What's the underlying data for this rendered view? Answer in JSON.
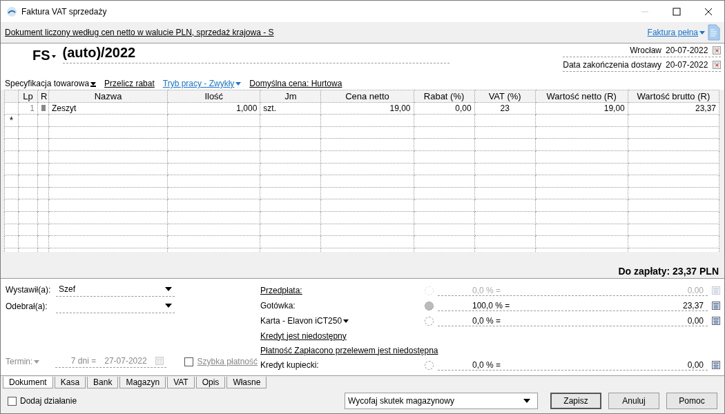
{
  "window": {
    "title": "Faktura VAT sprzedaży"
  },
  "info_bar": {
    "text": "Dokument liczony według cen netto w walucie PLN, sprzedaż krajowa - S",
    "invoice_kind": "Faktura pełna"
  },
  "header": {
    "doc_type": "FS",
    "number": "(auto)/2022",
    "place": "Wrocław",
    "issue_date": "20-07-2022",
    "delivery_label": "Data zakończenia dostawy",
    "delivery_date": "20-07-2022"
  },
  "toolbar": {
    "spec": "Specyfikacja towarowa",
    "recalc": "Przelicz rabat",
    "mode": "Tryb pracy - Zwykły",
    "default_price": "Domyślna cena: Hurtowa"
  },
  "table": {
    "columns": [
      "Lp",
      "R",
      "Nazwa",
      "Ilość",
      "Jm",
      "Cena netto",
      "Rabat (%)",
      "VAT (%)",
      "Wartość netto (R)",
      "Wartość brutto (R)"
    ],
    "rows": [
      [
        "1",
        "",
        "Zeszyt",
        "1,000",
        "szt.",
        "19,00",
        "0,00",
        "23",
        "19,00",
        "23,37"
      ]
    ],
    "new_row_marker": "*"
  },
  "total": "Do zapłaty: 23,37 PLN",
  "form": {
    "issuer_label": "Wystawił(a):",
    "issuer": "Szef",
    "receiver_label": "Odebrał(a):",
    "term": {
      "label": "Termin:",
      "days": "7 dni =",
      "date": "27-07-2022",
      "disabled": true
    },
    "quick_payment": {
      "label": "Szybka płatność",
      "checked": false,
      "disabled": true
    }
  },
  "payments": [
    {
      "kind": "link",
      "label": "Przedpłata:",
      "selected": false,
      "disabled": true,
      "percent": "0,0 % =",
      "amount": "0,00"
    },
    {
      "kind": "plain",
      "label": "Gotówka:",
      "selected": true,
      "disabled": false,
      "percent": "100,0 % =",
      "amount": "23,37"
    },
    {
      "kind": "dropdown",
      "label": "Karta - Elavon iCT250",
      "selected": false,
      "disabled": false,
      "percent": "0,0 % =",
      "amount": "0,00"
    },
    {
      "kind": "notice",
      "label": "Kredyt jest niedostępny"
    },
    {
      "kind": "notice",
      "label": "Płatność Zapłacono przelewem jest niedostępna"
    },
    {
      "kind": "plain",
      "label": "Kredyt kupiecki:",
      "selected": false,
      "disabled": false,
      "percent": "0,0 % =",
      "amount": "0,00"
    }
  ],
  "tabs": [
    {
      "label": "Dokument",
      "selected": true
    },
    {
      "label": "Kasa",
      "selected": false
    },
    {
      "label": "Bank",
      "selected": false
    },
    {
      "label": "Magazyn",
      "selected": false
    },
    {
      "label": "VAT",
      "selected": false
    },
    {
      "label": "Opis",
      "selected": false
    },
    {
      "label": "Własne",
      "selected": false
    }
  ],
  "footer": {
    "add_action": {
      "label": "Dodaj działanie",
      "checked": false
    },
    "action": "Wycofaj skutek magazynowy",
    "buttons": [
      "Zapisz",
      "Anuluj",
      "Pomoc"
    ]
  }
}
